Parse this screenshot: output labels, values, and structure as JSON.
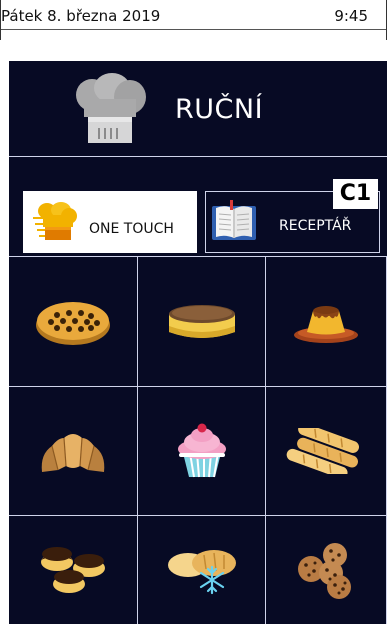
{
  "status": {
    "date": "Pátek 8. března 2019",
    "time": "9:45"
  },
  "header": {
    "title": "RUČNÍ",
    "icon": "chef-hat-icon"
  },
  "modes": {
    "one_touch_label": "ONE TOUCH",
    "recipes_label": "RECEPTÁŘ",
    "badge": "C1"
  },
  "programs": [
    {
      "icon": "pie-icon"
    },
    {
      "icon": "cheesecake-icon"
    },
    {
      "icon": "flan-icon"
    },
    {
      "icon": "croissant-icon"
    },
    {
      "icon": "cupcake-icon"
    },
    {
      "icon": "baguettes-icon"
    },
    {
      "icon": "eclairs-icon"
    },
    {
      "icon": "frozen-bread-icon"
    },
    {
      "icon": "cookies-icon"
    }
  ],
  "colors": {
    "panel": "#070a24",
    "line": "#cfd3ea"
  }
}
